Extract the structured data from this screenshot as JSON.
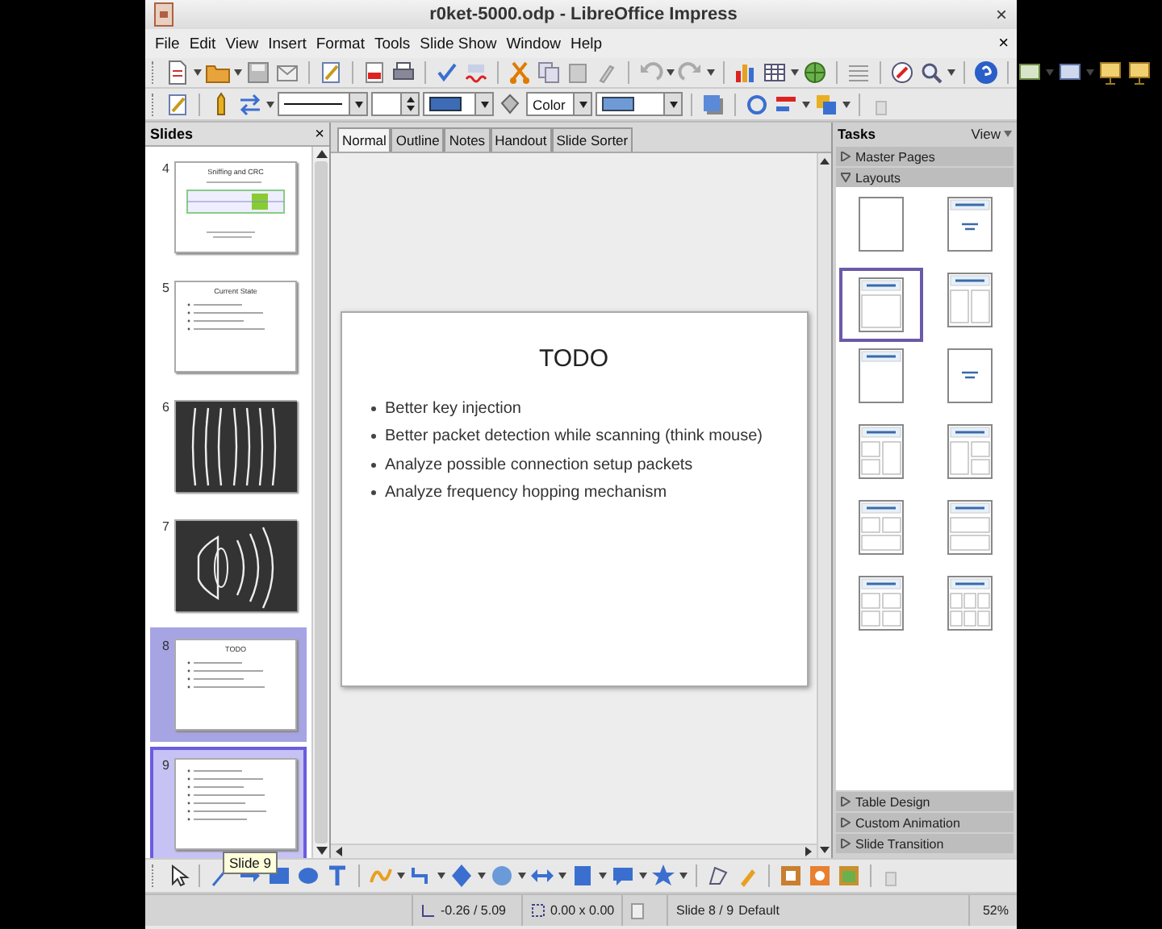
{
  "window": {
    "title": "r0ket-5000.odp - LibreOffice Impress",
    "close": "×"
  },
  "menu": {
    "items": [
      "File",
      "Edit",
      "View",
      "Insert",
      "Format",
      "Tools",
      "Slide Show",
      "Window",
      "Help"
    ],
    "close": "×"
  },
  "format_toolbar": {
    "area_style": "Color"
  },
  "slides_pane": {
    "title": "Slides",
    "close": "×",
    "tooltip": "Slide 9",
    "slides": [
      {
        "number": "4",
        "kind": "table",
        "title": "Sniffing and CRC",
        "selected": false,
        "hovered": false
      },
      {
        "number": "5",
        "kind": "text",
        "title": "Current State",
        "selected": false,
        "hovered": false
      },
      {
        "number": "6",
        "kind": "lines",
        "selected": false,
        "hovered": false
      },
      {
        "number": "7",
        "kind": "speaker",
        "selected": false,
        "hovered": false
      },
      {
        "number": "8",
        "kind": "text",
        "title": "TODO",
        "selected": true,
        "hovered": false
      },
      {
        "number": "9",
        "kind": "text",
        "selected": false,
        "hovered": true
      }
    ]
  },
  "view_tabs": [
    {
      "label": "Normal",
      "selected": true
    },
    {
      "label": "Outline",
      "selected": false
    },
    {
      "label": "Notes",
      "selected": false
    },
    {
      "label": "Handout",
      "selected": false
    },
    {
      "label": "Slide Sorter",
      "selected": false
    }
  ],
  "slide": {
    "title": "TODO",
    "bullets": [
      "Better key injection",
      "Better packet detection while scanning (think mouse)",
      "Analyze possible connection setup packets",
      "Analyze frequency hopping mechanism"
    ]
  },
  "tasks_pane": {
    "title": "Tasks",
    "view": "View",
    "sections_top": [
      {
        "label": "Master Pages",
        "expanded": false
      },
      {
        "label": "Layouts",
        "expanded": true
      }
    ],
    "layouts": [
      {
        "kind": "blank",
        "selected": false
      },
      {
        "kind": "title-subtitle",
        "selected": false
      },
      {
        "kind": "title-content",
        "selected": true
      },
      {
        "kind": "title-2-content",
        "selected": false
      },
      {
        "kind": "title-only",
        "selected": false
      },
      {
        "kind": "centered-text",
        "selected": false
      },
      {
        "kind": "title-2content-content",
        "selected": false
      },
      {
        "kind": "title-content-2content",
        "selected": false
      },
      {
        "kind": "title-2content-over-content",
        "selected": false
      },
      {
        "kind": "title-content-over-content",
        "selected": false
      },
      {
        "kind": "title-4-content",
        "selected": false
      },
      {
        "kind": "title-6-content",
        "selected": false
      }
    ],
    "sections_bottom": [
      {
        "label": "Table Design",
        "expanded": false
      },
      {
        "label": "Custom Animation",
        "expanded": false
      },
      {
        "label": "Slide Transition",
        "expanded": false
      }
    ]
  },
  "status_bar": {
    "position": "-0.26 / 5.09",
    "size": "0.00 x 0.00",
    "slide": "Slide 8 / 9",
    "master": "Default",
    "zoom": "52%"
  }
}
